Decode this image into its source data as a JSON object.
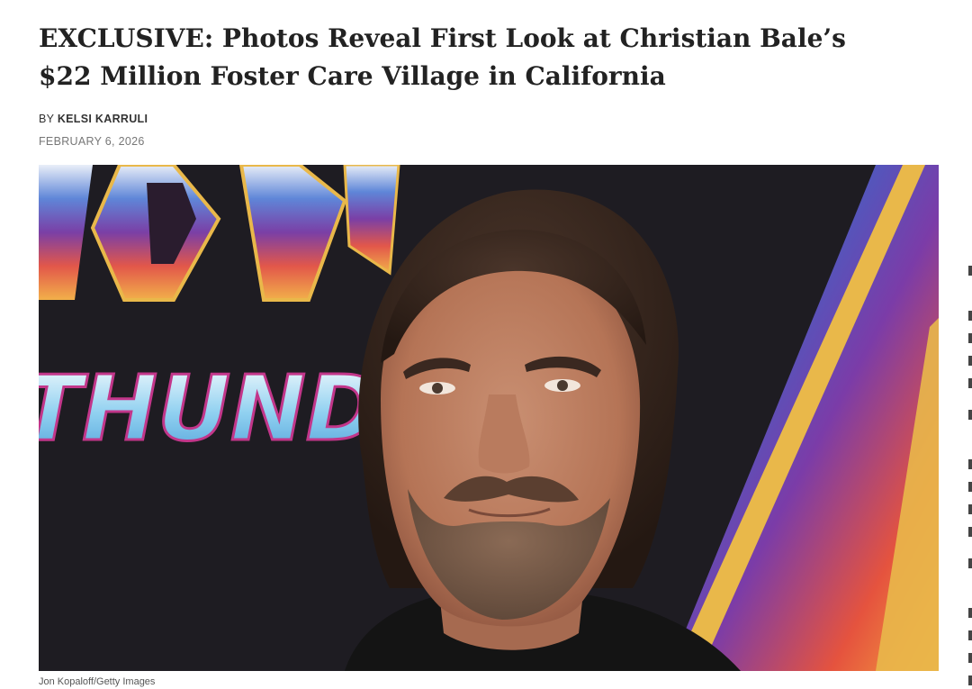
{
  "article": {
    "headline": "EXCLUSIVE: Photos Reveal First Look at Christian Bale’s $22 Million Foster Care Village in California",
    "byline_prefix": "BY",
    "author": "KELSI KARRULI",
    "date": "FEBRUARY 6, 2026"
  },
  "hero_image": {
    "alt": "Christian Bale",
    "backdrop_text": "THUNDER",
    "caption": "Jon Kopaloff/Getty Images"
  },
  "colors": {
    "headline": "#222222",
    "meta": "#777777",
    "backdrop": "#1e1c22"
  }
}
